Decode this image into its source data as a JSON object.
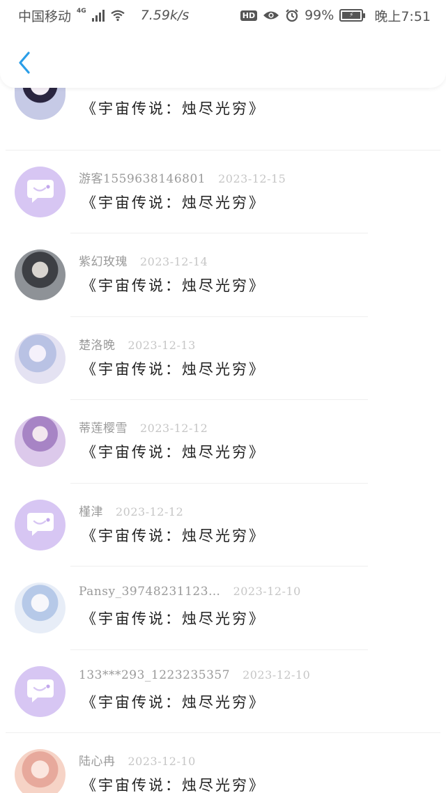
{
  "status_bar": {
    "carrier": "中国移动",
    "network": "4G",
    "speed": "7.59k/s",
    "hd": "HD",
    "battery": "99%",
    "time": "晚上7:51"
  },
  "nav": {
    "back_icon": "chevron-left-icon",
    "accent": "#2a9ee8"
  },
  "comments": [
    {
      "name": "",
      "date": "",
      "text": "《宇宙传说：烛尽光穷》",
      "avatar": "photo1"
    },
    {
      "name": "游客1559638146801",
      "date": "2023-12-15",
      "text": "《宇宙传说：烛尽光穷》",
      "avatar": "default"
    },
    {
      "name": "紫幻玫瑰",
      "date": "2023-12-14",
      "text": "《宇宙传说：烛尽光穷》",
      "avatar": "photo2"
    },
    {
      "name": "楚洛晚",
      "date": "2023-12-13",
      "text": "《宇宙传说：烛尽光穷》",
      "avatar": "photo3"
    },
    {
      "name": "蒂莲樱雪",
      "date": "2023-12-12",
      "text": "《宇宙传说：烛尽光穷》",
      "avatar": "photo4"
    },
    {
      "name": "槿津",
      "date": "2023-12-12",
      "text": "《宇宙传说：烛尽光穷》",
      "avatar": "default"
    },
    {
      "name": "Pansy_39748231123…",
      "date": "2023-12-10",
      "text": "《宇宙传说：烛尽光穷》",
      "avatar": "photo5"
    },
    {
      "name": "133***293_1223235357",
      "date": "2023-12-10",
      "text": "《宇宙传说：烛尽光穷》",
      "avatar": "default"
    },
    {
      "name": "陆心冉",
      "date": "2023-12-10",
      "text": "《宇宙传说：烛尽光穷》",
      "avatar": "photo6"
    }
  ]
}
